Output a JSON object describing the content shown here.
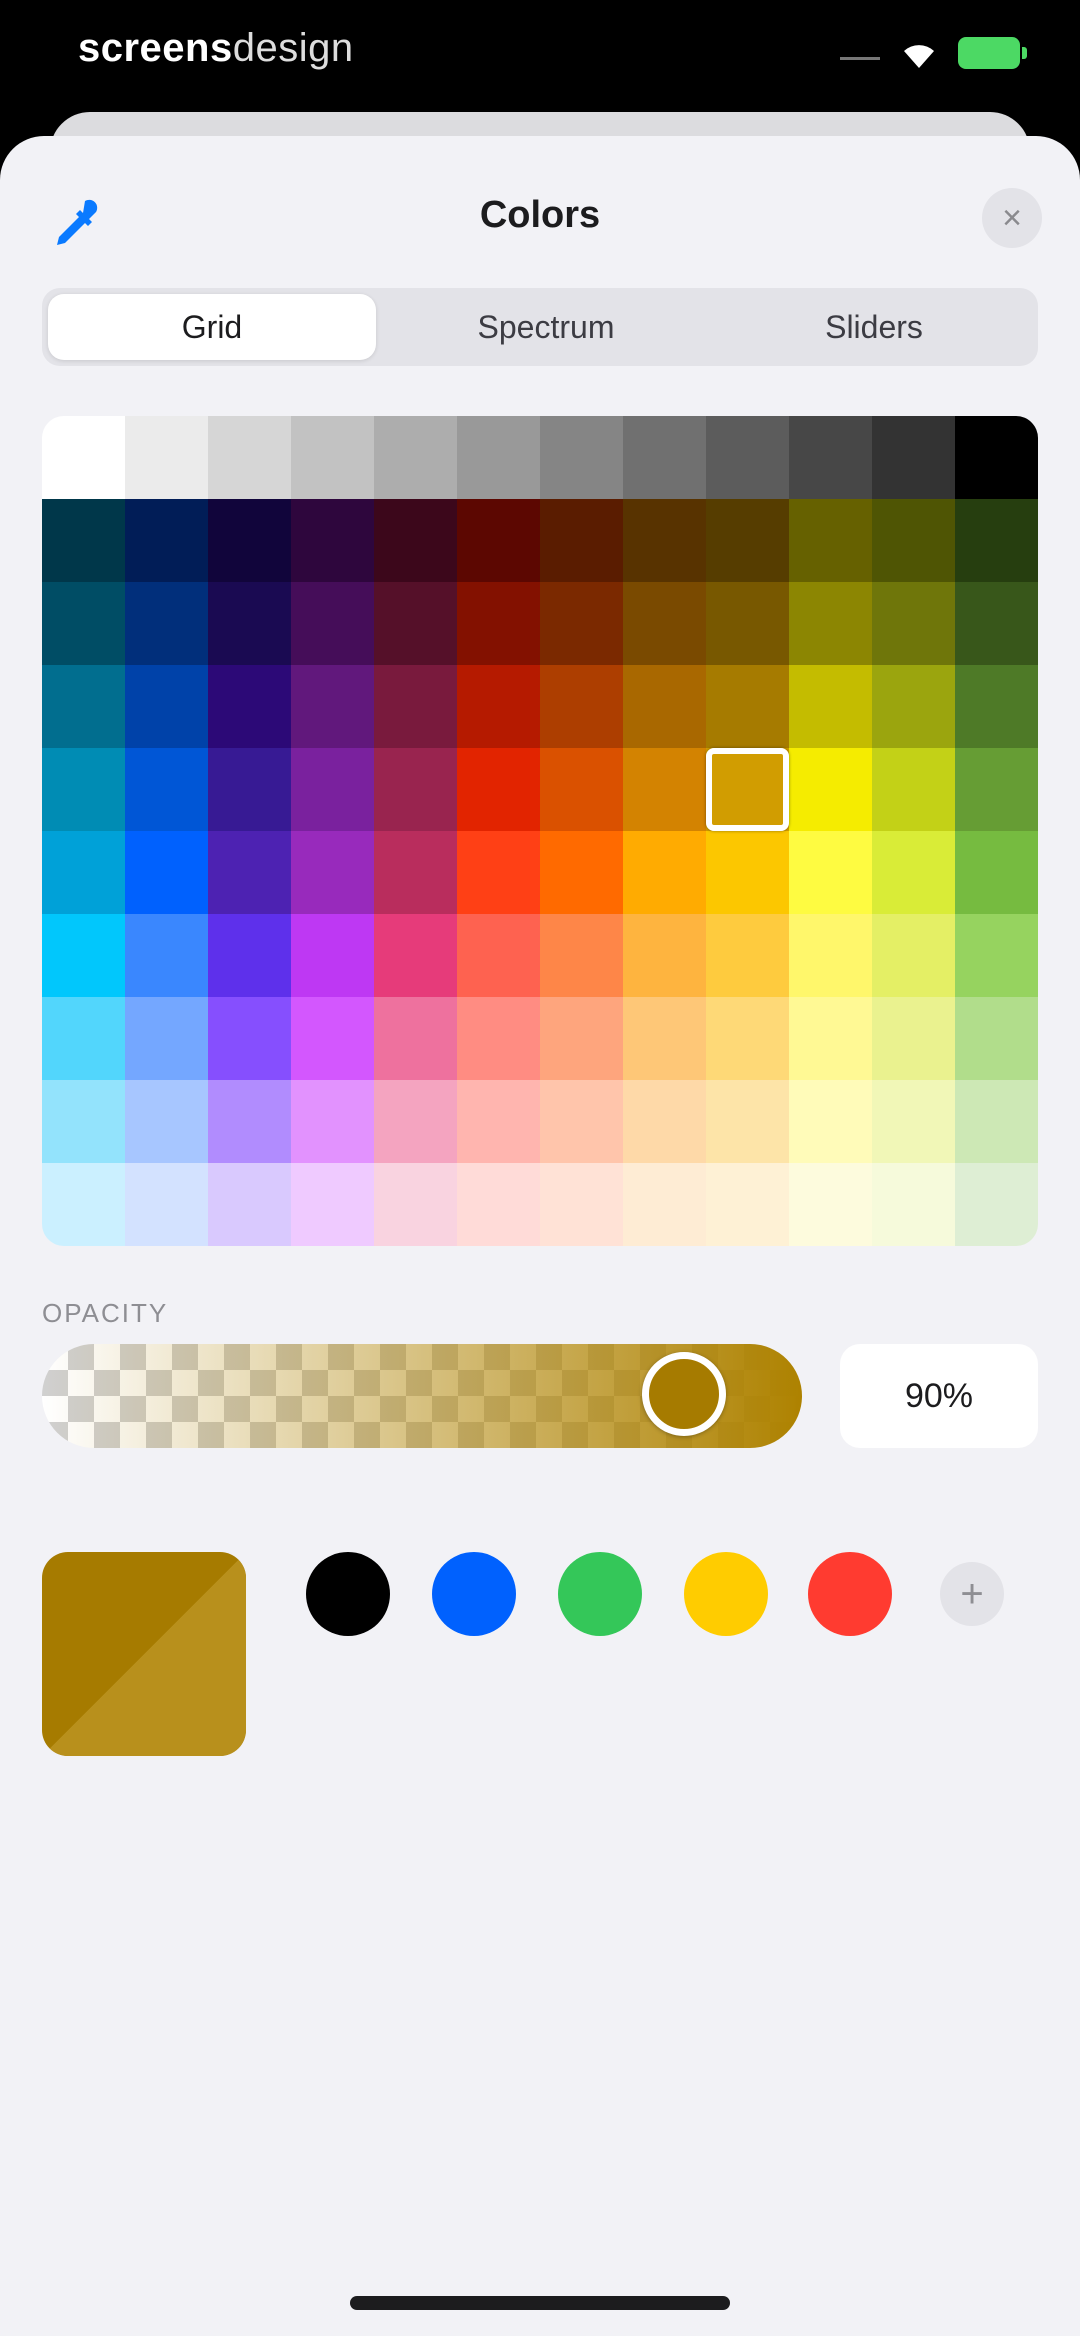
{
  "status_bar": {
    "brand_bold": "screens",
    "brand_thin": "design"
  },
  "picker": {
    "title": "Colors",
    "close_symbol": "×",
    "tabs": [
      {
        "label": "Grid",
        "active": true
      },
      {
        "label": "Spectrum",
        "active": false
      },
      {
        "label": "Sliders",
        "active": false
      }
    ],
    "grid": {
      "columns": 12,
      "grayscale": [
        "#ffffff",
        "#ebebeb",
        "#d6d6d6",
        "#c2c2c2",
        "#adadad",
        "#999999",
        "#858585",
        "#707070",
        "#5c5c5c",
        "#474747",
        "#333333",
        "#000000"
      ],
      "colors": [
        [
          "#00374a",
          "#011d57",
          "#11053b",
          "#2e063d",
          "#3c071b",
          "#5c0701",
          "#5a1c00",
          "#583300",
          "#563d00",
          "#666100",
          "#4f5504",
          "#263e0f"
        ],
        [
          "#004d65",
          "#012f7b",
          "#1a0a52",
          "#450d59",
          "#551029",
          "#831100",
          "#7b2900",
          "#7a4a00",
          "#785800",
          "#8c8602",
          "#6f760a",
          "#38571a"
        ],
        [
          "#016e8f",
          "#0042a9",
          "#2c0977",
          "#61187c",
          "#791a3d",
          "#b51a00",
          "#ad3e00",
          "#a96800",
          "#a67b00",
          "#c4bc00",
          "#9ba50e",
          "#4e7a27"
        ],
        [
          "#008cb4",
          "#0056d6",
          "#371a94",
          "#7a219e",
          "#99244f",
          "#e22400",
          "#da5100",
          "#d38301",
          "#d19d01",
          "#f5ec00",
          "#c3d117",
          "#669d34"
        ],
        [
          "#00a1d8",
          "#0061fe",
          "#4d22b2",
          "#982abc",
          "#b92d5d",
          "#ff4015",
          "#ff6a00",
          "#ffab01",
          "#fcc700",
          "#fefb41",
          "#d9ec37",
          "#76bb40"
        ],
        [
          "#01c7fc",
          "#3a87fe",
          "#5e30eb",
          "#be38f3",
          "#e63b7a",
          "#fe6250",
          "#fe8648",
          "#feb43f",
          "#fecb3e",
          "#fff76b",
          "#e4ef65",
          "#96d35f"
        ],
        [
          "#52d6fc",
          "#74a7ff",
          "#864ffe",
          "#d357fe",
          "#ee719e",
          "#ff8c82",
          "#fea57d",
          "#fec777",
          "#fed977",
          "#fff994",
          "#eaf28f",
          "#b1dd8b"
        ],
        [
          "#93e3fc",
          "#a7c6ff",
          "#b18cfe",
          "#e292fe",
          "#f4a4c0",
          "#ffb5af",
          "#ffc5ab",
          "#fed9a8",
          "#fde4a8",
          "#fffbb9",
          "#f1f7b7",
          "#cde8b5"
        ],
        [
          "#cbf0ff",
          "#d3e2ff",
          "#d9c9fe",
          "#efcaff",
          "#f9d3e0",
          "#ffdbd8",
          "#ffe2d6",
          "#feecd4",
          "#fef1d5",
          "#fdfbdd",
          "#f6fadb",
          "#deeed4"
        ]
      ],
      "selected": {
        "row": 3,
        "col": 8
      }
    },
    "opacity": {
      "label": "OPACITY",
      "value_text": "90%",
      "value": 0.9
    },
    "current_color": "#a67b00",
    "favorites": [
      "#000000",
      "#0061fe",
      "#34c759",
      "#ffcc00",
      "#ff3b30"
    ],
    "add_symbol": "+"
  }
}
